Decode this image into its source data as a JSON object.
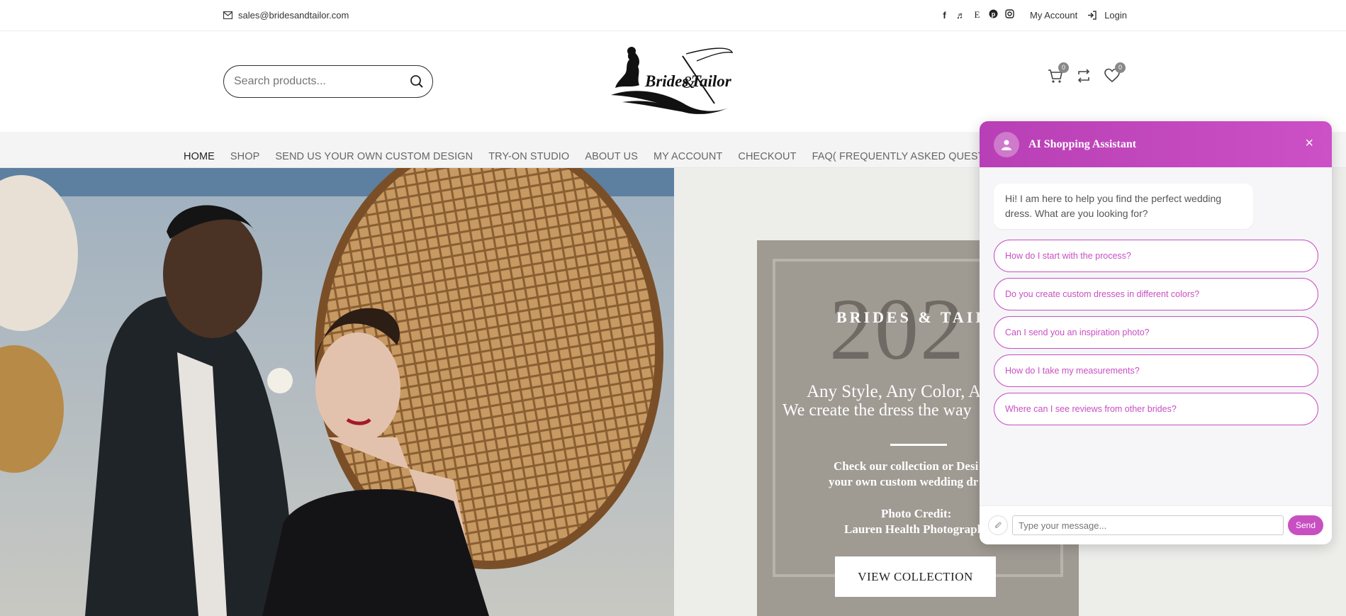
{
  "topbar": {
    "email": "sales@bridesandtailor.com",
    "social_icons": [
      "facebook-icon",
      "tiktok-icon",
      "etsy-icon",
      "pinterest-icon",
      "instagram-icon"
    ],
    "etsy_glyph": "E",
    "my_account": "My Account",
    "login": "Login"
  },
  "header": {
    "search_placeholder": "Search products...",
    "logo_text": "Brides & Tailor",
    "cart_count": "0",
    "wishlist_count": "0"
  },
  "nav": {
    "items": [
      "HOME",
      "SHOP",
      "SEND US YOUR OWN CUSTOM DESIGN",
      "TRY-ON STUDIO",
      "ABOUT US",
      "MY ACCOUNT",
      "CHECKOUT",
      "FAQ( FREQUENTLY ASKED QUESTIONS"
    ]
  },
  "hero": {
    "year": "202",
    "brand": "BRIDES & TAIL",
    "tagline1": "Any Style, Any Color, A",
    "tagline2": "We create the dress the way",
    "check1": "Check our collection or Desi",
    "check2": "your own custom wedding dr",
    "credit1": "Photo Credit:",
    "credit2": "Lauren Health Photograph",
    "button": "VIEW COLLECTION"
  },
  "chat": {
    "title": "AI Shopping Assistant",
    "close": "×",
    "greeting": "Hi! I am here to help you find the perfect wedding dress. What are you looking for?",
    "suggestions": [
      "How do I start with the process?",
      "Do you create custom dresses in different colors?",
      "Can I send you an inspiration photo?",
      "How do I take my measurements?",
      "Where can I see reviews from other brides?"
    ],
    "input_placeholder": "Type your message...",
    "send": "Send"
  },
  "colors": {
    "accent": "#c84fc2",
    "panel": "#9f9a92"
  }
}
